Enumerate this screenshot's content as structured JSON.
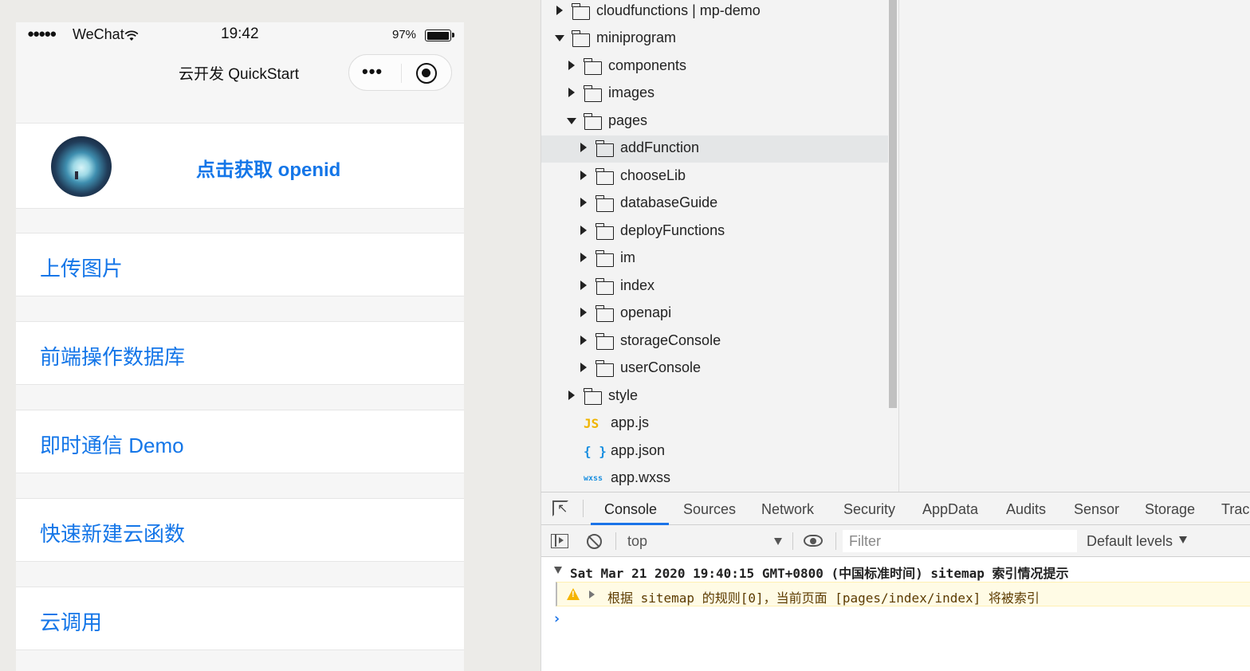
{
  "simulator": {
    "status_bar": {
      "signal": "●●●●●",
      "carrier": "WeChat",
      "time": "19:42",
      "battery": "97%",
      "battery_level": 0.97
    },
    "nav_title": "云开发 QuickStart",
    "capsule": {
      "more_icon": "•••"
    },
    "user_card": {
      "openid_button": "点击获取 openid"
    },
    "menu": [
      "上传图片",
      "前端操作数据库",
      "即时通信 Demo",
      "快速新建云函数",
      "云调用"
    ]
  },
  "file_tree": [
    {
      "label": "cloudfunctions | mp-demo",
      "kind": "cloud-folder",
      "expanded": false
    },
    {
      "label": "miniprogram",
      "kind": "folder",
      "expanded": true
    },
    {
      "label": "components",
      "kind": "folder",
      "expanded": false
    },
    {
      "label": "images",
      "kind": "folder",
      "expanded": false
    },
    {
      "label": "pages",
      "kind": "folder",
      "expanded": true
    },
    {
      "label": "addFunction",
      "kind": "folder",
      "expanded": false,
      "selected": true
    },
    {
      "label": "chooseLib",
      "kind": "folder",
      "expanded": false
    },
    {
      "label": "databaseGuide",
      "kind": "folder",
      "expanded": false
    },
    {
      "label": "deployFunctions",
      "kind": "folder",
      "expanded": false
    },
    {
      "label": "im",
      "kind": "folder",
      "expanded": false
    },
    {
      "label": "index",
      "kind": "folder",
      "expanded": false
    },
    {
      "label": "openapi",
      "kind": "folder",
      "expanded": false
    },
    {
      "label": "storageConsole",
      "kind": "folder",
      "expanded": false
    },
    {
      "label": "userConsole",
      "kind": "folder",
      "expanded": false
    },
    {
      "label": "style",
      "kind": "folder",
      "expanded": false
    },
    {
      "label": "app.js",
      "kind": "file",
      "badge": "JS",
      "badge_color": "#f0b400"
    },
    {
      "label": "app.json",
      "kind": "file",
      "badge": "{ }",
      "badge_color": "#1a8fe0"
    },
    {
      "label": "app.wxss",
      "kind": "file",
      "badge": "wxss",
      "badge_color": "#1a8fe0"
    }
  ],
  "devtools": {
    "tabs": [
      "Console",
      "Sources",
      "Network",
      "Security",
      "AppData",
      "Audits",
      "Sensor",
      "Storage",
      "Trace"
    ],
    "active_tab": "Console",
    "toolbar": {
      "context": "top",
      "filter_placeholder": "Filter",
      "levels": "Default levels"
    },
    "log": {
      "group_header": "Sat Mar 21 2020 19:40:15 GMT+0800 (中国标准时间) sitemap 索引情况提示",
      "warning": "根据 sitemap 的规则[0]，当前页面 [pages/index/index] 将被索引",
      "prompt": "›"
    }
  },
  "colors": {
    "accent_blue": "#1476e8",
    "devtools_blue": "#1a73e8",
    "warning_bg": "#fffbe5",
    "warning_text": "#5c3b00"
  }
}
